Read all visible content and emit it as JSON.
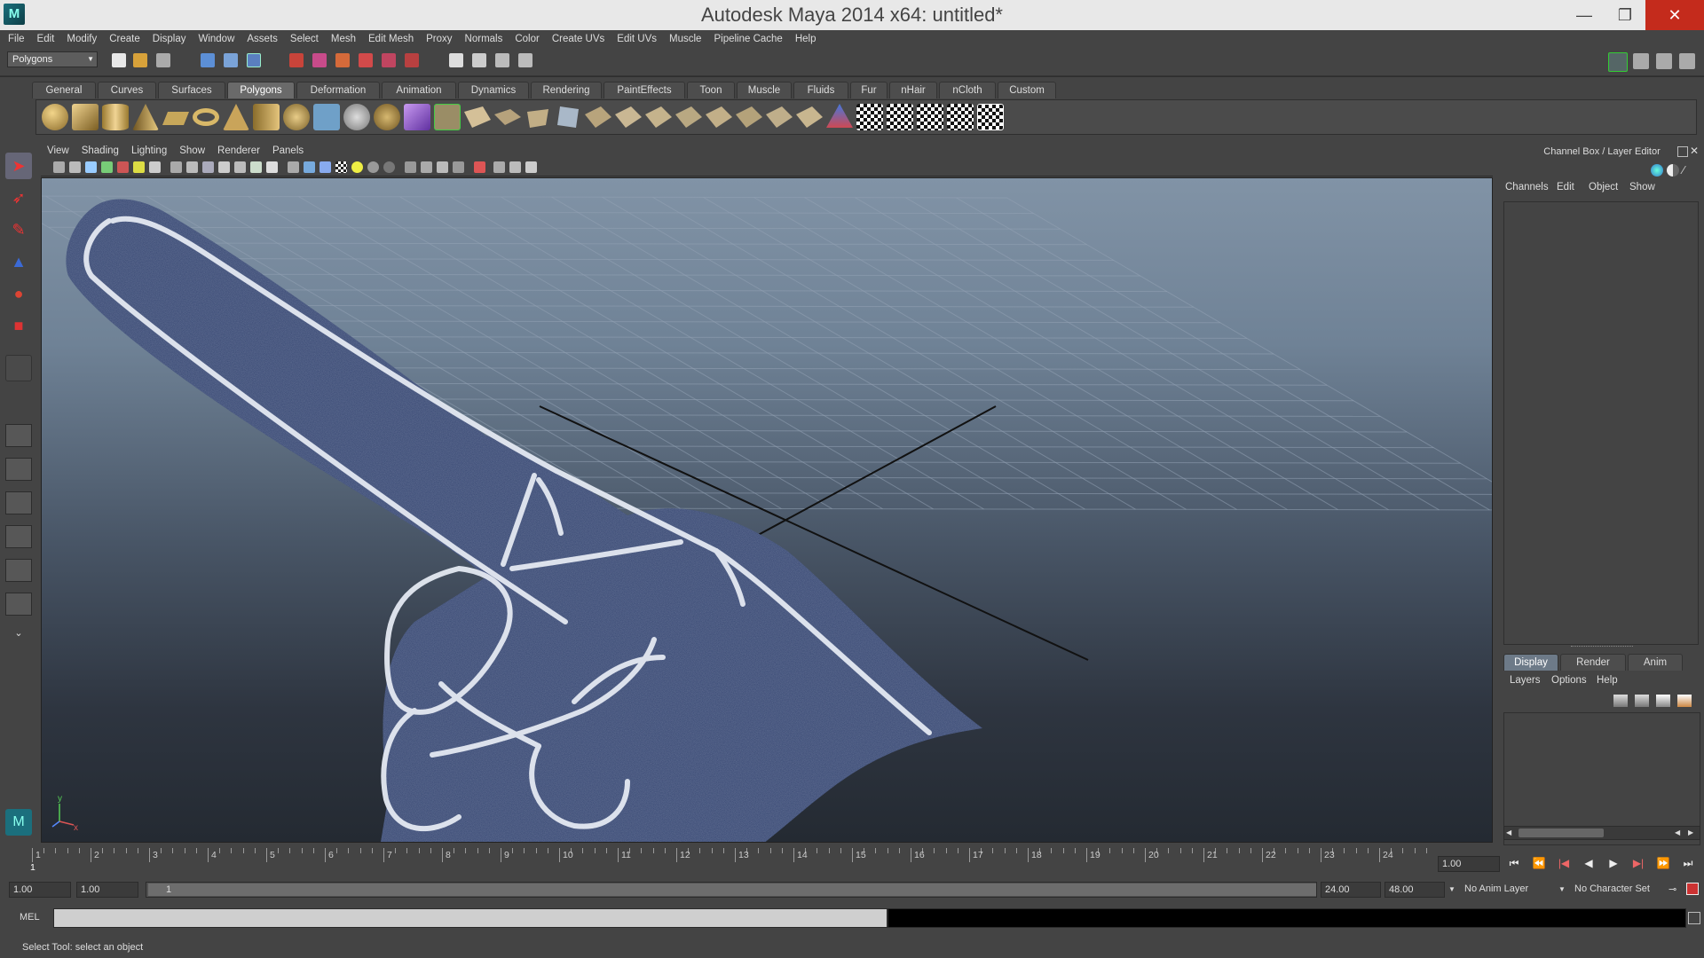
{
  "window": {
    "title": "Autodesk Maya 2014 x64: untitled*",
    "controls": {
      "minimize": "—",
      "maximize": "❐",
      "close": "✕"
    }
  },
  "menubar": [
    "File",
    "Edit",
    "Modify",
    "Create",
    "Display",
    "Window",
    "Assets",
    "Select",
    "Mesh",
    "Edit Mesh",
    "Proxy",
    "Normals",
    "Color",
    "Create UVs",
    "Edit UVs",
    "Muscle",
    "Pipeline Cache",
    "Help"
  ],
  "statusline": {
    "menuset": "Polygons"
  },
  "shelf": {
    "tabs": [
      "General",
      "Curves",
      "Surfaces",
      "Polygons",
      "Deformation",
      "Animation",
      "Dynamics",
      "Rendering",
      "PaintEffects",
      "Toon",
      "Muscle",
      "Fluids",
      "Fur",
      "nHair",
      "nCloth",
      "Custom"
    ],
    "active_tab": "Polygons"
  },
  "viewport": {
    "menu": [
      "View",
      "Shading",
      "Lighting",
      "Show",
      "Renderer",
      "Panels"
    ],
    "axis": {
      "x_label": "x",
      "y_label": "y"
    }
  },
  "channel_box": {
    "title": "Channel Box / Layer Editor",
    "menu": [
      "Channels",
      "Edit",
      "Object",
      "Show"
    ]
  },
  "layer_editor": {
    "tabs": [
      "Display",
      "Render",
      "Anim"
    ],
    "active_tab": "Display",
    "menu": [
      "Layers",
      "Options",
      "Help"
    ]
  },
  "timeslider": {
    "labels": [
      "1",
      "2",
      "3",
      "4",
      "5",
      "6",
      "7",
      "8",
      "9",
      "10",
      "11",
      "12",
      "13",
      "14",
      "15",
      "16",
      "17",
      "18",
      "19",
      "20",
      "21",
      "22",
      "23",
      "24"
    ],
    "current_frame_marker": "1",
    "current_frame": "1.00"
  },
  "range": {
    "start": "1.00",
    "playback_start": "1.00",
    "slider_label": "1",
    "playback_end": "24.00",
    "end": "48.00",
    "anim_layer": "No Anim Layer",
    "character_set": "No Character Set"
  },
  "cmdline": {
    "label": "MEL"
  },
  "helpline": {
    "text": "Select Tool: select an object"
  },
  "colors": {
    "accent_tab": "#6a6a6a",
    "close_red": "#c42b1c",
    "foam_finger": "#2b3c69"
  }
}
